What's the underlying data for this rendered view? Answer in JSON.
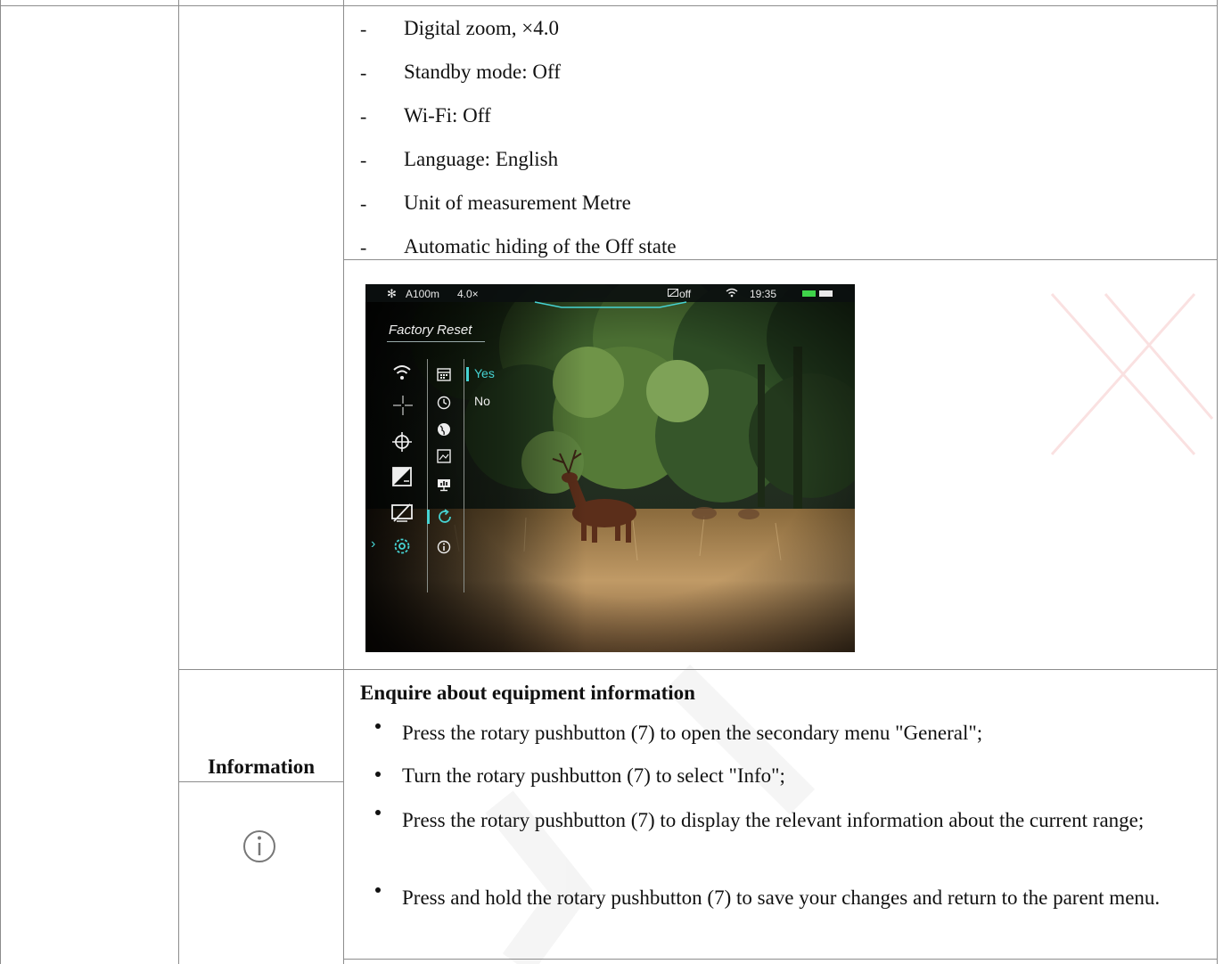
{
  "settings_list": [
    "Digital zoom, ×4.0",
    "Standby mode: Off",
    "Wi-Fi: Off",
    "Language: English",
    "Unit of measurement Metre",
    "Automatic hiding of the Off state"
  ],
  "dash_symbol": "-",
  "device_screen": {
    "status_bar": {
      "range": "A100m",
      "zoom": "4.0×",
      "display_status": "off",
      "time": "19:35"
    },
    "menu_title": "Factory Reset",
    "options": [
      "Yes",
      "No"
    ],
    "selected_option": "Yes",
    "accent_color": "#46d3d3",
    "main_menu_icons": [
      "wifi-icon",
      "crosshair-icon",
      "target-icon",
      "contrast-icon",
      "display-off-icon",
      "gear-icon"
    ],
    "submenu_icons": [
      "calendar-icon",
      "clock-icon",
      "globe-icon",
      "image-icon",
      "monitor-icon",
      "reset-icon",
      "info-icon"
    ]
  },
  "information_section": {
    "label": "Information",
    "icon": "info-circle-icon",
    "heading": "Enquire about equipment information",
    "steps": [
      "Press the rotary pushbutton (7) to open the secondary menu \"General\";",
      "Turn the rotary pushbutton (7) to select \"Info\";",
      "Press the rotary pushbutton (7) to display the relevant information about the current range;",
      "Press and hold the rotary pushbutton (7) to save your changes and return to the parent menu."
    ]
  }
}
